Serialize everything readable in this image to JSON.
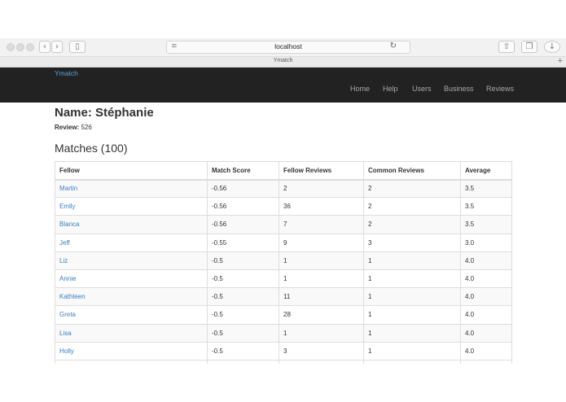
{
  "browser": {
    "url": "localhost",
    "tab_title": "Ymatch",
    "new_tab": "+"
  },
  "navbar": {
    "brand": "Ymatch",
    "items": [
      "Home",
      "Help",
      "Users",
      "Business",
      "Reviews"
    ]
  },
  "profile": {
    "name": "Name: Stéphanie",
    "review_label": "Review:",
    "review_value": "526"
  },
  "matches": {
    "heading": "Matches (100)",
    "columns": [
      "Fellow",
      "Match Score",
      "Fellow Reviews",
      "Common Reviews",
      "Average"
    ],
    "rows": [
      [
        "Martin",
        "-0.56",
        "2",
        "2",
        "3.5"
      ],
      [
        "Emily",
        "-0.56",
        "36",
        "2",
        "3.5"
      ],
      [
        "Blanca",
        "-0.56",
        "7",
        "2",
        "3.5"
      ],
      [
        "Jeff",
        "-0.55",
        "9",
        "3",
        "3.0"
      ],
      [
        "Liz",
        "-0.5",
        "1",
        "1",
        "4.0"
      ],
      [
        "Annie",
        "-0.5",
        "1",
        "1",
        "4.0"
      ],
      [
        "Kathleen",
        "-0.5",
        "11",
        "1",
        "4.0"
      ],
      [
        "Greta",
        "-0.5",
        "28",
        "1",
        "4.0"
      ],
      [
        "Lisa",
        "-0.5",
        "1",
        "1",
        "4.0"
      ],
      [
        "Holly",
        "-0.5",
        "3",
        "1",
        "4.0"
      ]
    ]
  }
}
